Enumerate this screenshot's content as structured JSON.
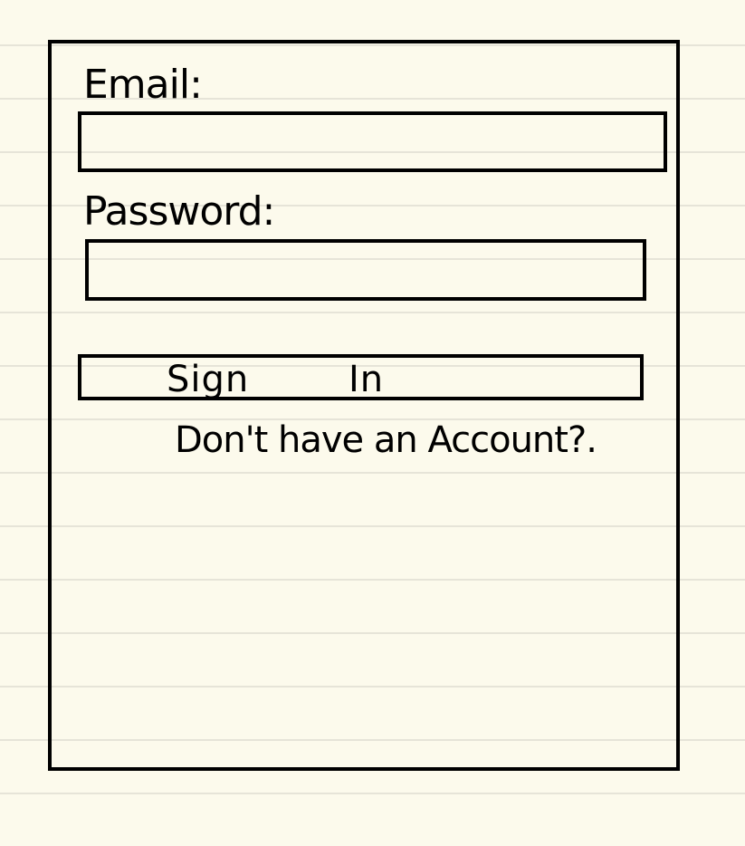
{
  "form": {
    "email_label": "Email:",
    "email_value": "",
    "password_label": "Password:",
    "password_value": "",
    "signin_label": "Sign        In",
    "signup_prompt": "Don't have an Account?."
  }
}
